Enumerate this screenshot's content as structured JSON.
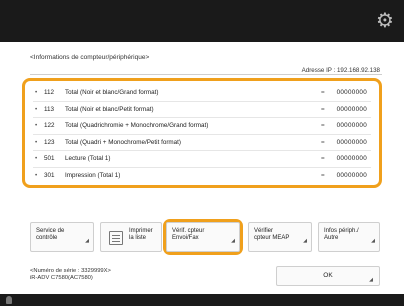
{
  "header": {
    "title": "<Informations de compteur/périphérique>",
    "address": "Adresse IP : 192.168.92.138"
  },
  "counters": [
    {
      "bullet": "•",
      "number": "112",
      "label": "Total (Noir et blanc/Grand format)",
      "eq": "=",
      "value": "00000000"
    },
    {
      "bullet": "•",
      "number": "113",
      "label": "Total (Noir et blanc/Petit format)",
      "eq": "=",
      "value": "00000000"
    },
    {
      "bullet": "•",
      "number": "122",
      "label": "Total (Quadrichromie + Monochrome/Grand format)",
      "eq": "=",
      "value": "00000000"
    },
    {
      "bullet": "•",
      "number": "123",
      "label": "Total (Quadri + Monochrome/Petit format)",
      "eq": "=",
      "value": "00000000"
    },
    {
      "bullet": "•",
      "number": "501",
      "label": "Lecture (Total 1)",
      "eq": "=",
      "value": "00000000"
    },
    {
      "bullet": "•",
      "number": "301",
      "label": "Impression (Total 1)",
      "eq": "=",
      "value": "00000000"
    }
  ],
  "buttons": {
    "service": {
      "line1": "Service de",
      "line2": "contrôle"
    },
    "print": {
      "line1": "Imprimer",
      "line2": "la liste"
    },
    "verif": {
      "line1": "Vérif. cpteur",
      "line2": "Envoi/Fax"
    },
    "mibe": {
      "line1": "Vérifier",
      "line2": "cpteur MEAP"
    },
    "infos": {
      "line1": "Infos périph./",
      "line2": "Autre"
    },
    "ok": "OK"
  },
  "serial": {
    "line1": "<Numéro de série : 3329999X>",
    "line2": "iR-ADV C7580(AC7580)"
  },
  "icons": {
    "gear": "gear-icon",
    "print": "list-print-icon",
    "caret": "caret-icon"
  },
  "colors": {
    "highlight": "#f0a01c",
    "topbar": "#1a1a1a"
  }
}
